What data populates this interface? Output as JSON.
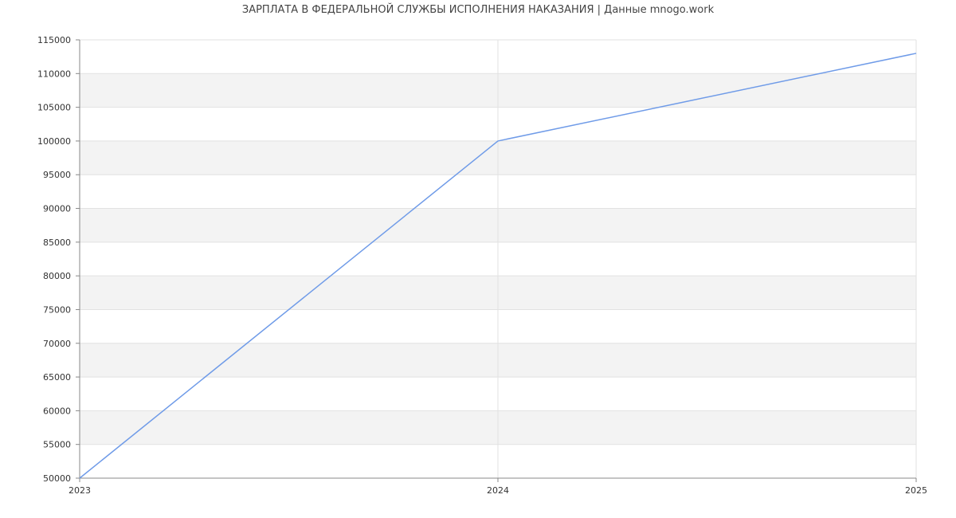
{
  "chart_data": {
    "type": "line",
    "title": "ЗАРПЛАТА В ФЕДЕРАЛЬНОЙ СЛУЖБЫ ИСПОЛНЕНИЯ НАКАЗАНИЯ | Данные mnogo.work",
    "xlabel": "",
    "ylabel": "",
    "x": [
      "2023",
      "2024",
      "2025"
    ],
    "series": [
      {
        "values": [
          50000,
          100000,
          113000
        ],
        "color": "#6f9be8"
      }
    ],
    "ylim": [
      50000,
      115000
    ],
    "ytick_step": 5000,
    "grid": true,
    "band_color": "#f3f3f3",
    "grid_color": "#e2e2e2",
    "axis_color": "#888888"
  }
}
